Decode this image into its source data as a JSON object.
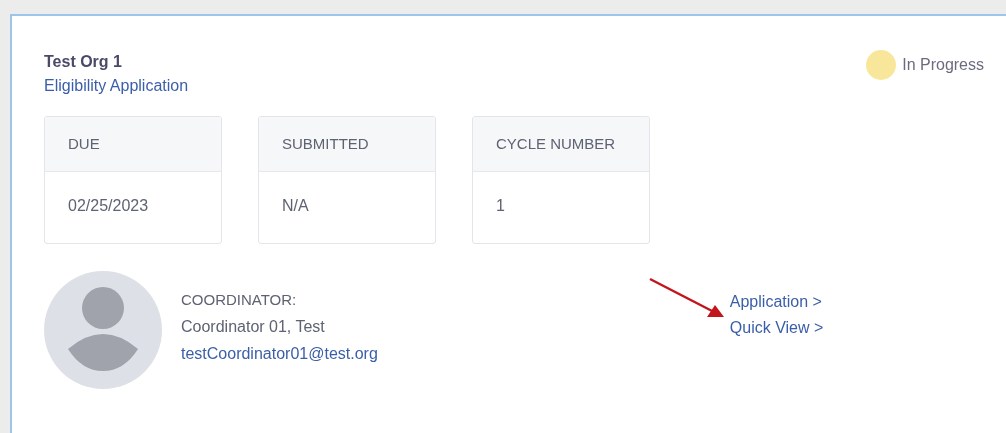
{
  "header": {
    "organization": "Test Org 1",
    "application_type": "Eligibility Application"
  },
  "status": {
    "label": "In Progress",
    "color": "#f8e79a"
  },
  "stats": [
    {
      "label": "DUE",
      "value": "02/25/2023"
    },
    {
      "label": "SUBMITTED",
      "value": "N/A"
    },
    {
      "label": "CYCLE NUMBER",
      "value": "1"
    }
  ],
  "coordinator": {
    "heading": "COORDINATOR:",
    "name": "Coordinator 01, Test",
    "email": "testCoordinator01@test.org"
  },
  "links": [
    "Application >",
    "Quick View >"
  ]
}
